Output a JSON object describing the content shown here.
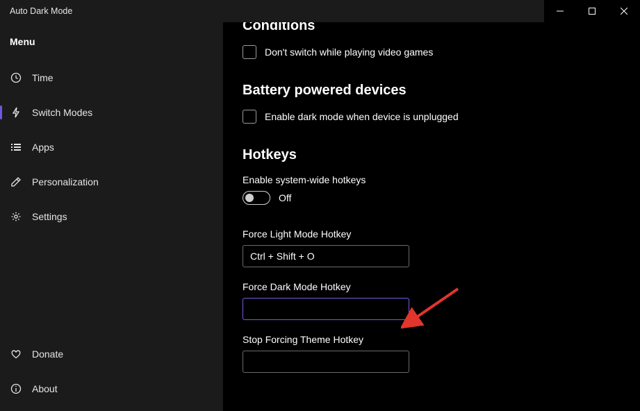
{
  "app": {
    "title": "Auto Dark Mode"
  },
  "sidebar": {
    "menuLabel": "Menu",
    "items": [
      {
        "label": "Time"
      },
      {
        "label": "Switch Modes"
      },
      {
        "label": "Apps"
      },
      {
        "label": "Personalization"
      },
      {
        "label": "Settings"
      }
    ],
    "bottom": [
      {
        "label": "Donate"
      },
      {
        "label": "About"
      }
    ]
  },
  "main": {
    "conditions": {
      "title": "Conditions",
      "checkboxLabel": "Don't switch while playing video games"
    },
    "battery": {
      "title": "Battery powered devices",
      "checkboxLabel": "Enable dark mode when device is unplugged"
    },
    "hotkeys": {
      "title": "Hotkeys",
      "enableLabel": "Enable system-wide hotkeys",
      "toggleState": "Off",
      "forceLight": {
        "label": "Force Light Mode Hotkey",
        "value": "Ctrl + Shift + O"
      },
      "forceDark": {
        "label": "Force Dark Mode Hotkey",
        "value": ""
      },
      "stopForcing": {
        "label": "Stop Forcing Theme Hotkey",
        "value": ""
      }
    }
  }
}
